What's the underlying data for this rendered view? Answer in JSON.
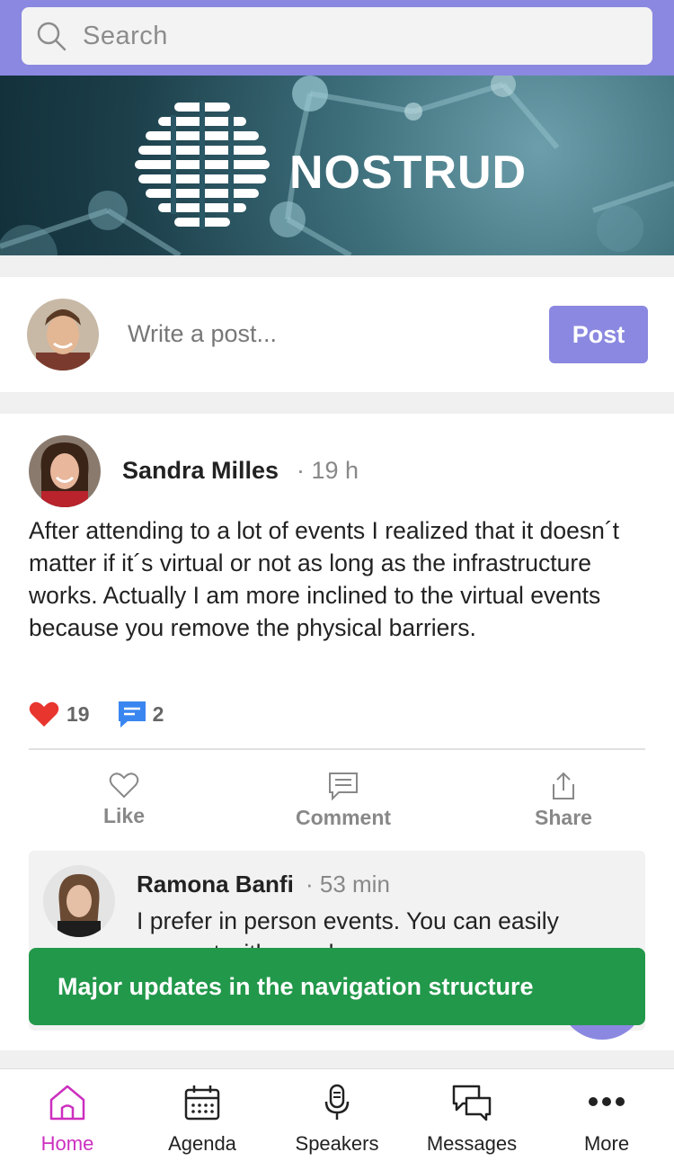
{
  "search": {
    "placeholder": "Search"
  },
  "banner": {
    "brand": "NOSTRUD"
  },
  "composer": {
    "placeholder": "Write a post...",
    "post_label": "Post"
  },
  "post": {
    "author": "Sandra Milles",
    "time": "· 19 h",
    "text": "After attending to a lot of events I realized that it doesn´t matter if it´s virtual or not as long as the infrastructure works. Actually I am more inclined to the virtual events because you remove the physical barriers.",
    "likes": "19",
    "comments": "2",
    "actions": {
      "like": "Like",
      "comment": "Comment",
      "share": "Share"
    }
  },
  "comment": {
    "author": "Ramona Banfi",
    "time": "· 53 min",
    "text": "I prefer in person events. You can easily connect with people"
  },
  "toast": {
    "message": "Major updates in the navigation structure"
  },
  "nav": [
    {
      "label": "Home",
      "icon": "home-icon",
      "active": true
    },
    {
      "label": "Agenda",
      "icon": "calendar-icon",
      "active": false
    },
    {
      "label": "Speakers",
      "icon": "microphone-icon",
      "active": false
    },
    {
      "label": "Messages",
      "icon": "messages-icon",
      "active": false
    },
    {
      "label": "More",
      "icon": "more-icon",
      "active": false
    }
  ],
  "colors": {
    "accent": "#8a88e0",
    "toast": "#22984a",
    "active_nav": "#cc2fbf",
    "heart": "#e8352e",
    "comment_icon": "#3a86f0"
  }
}
